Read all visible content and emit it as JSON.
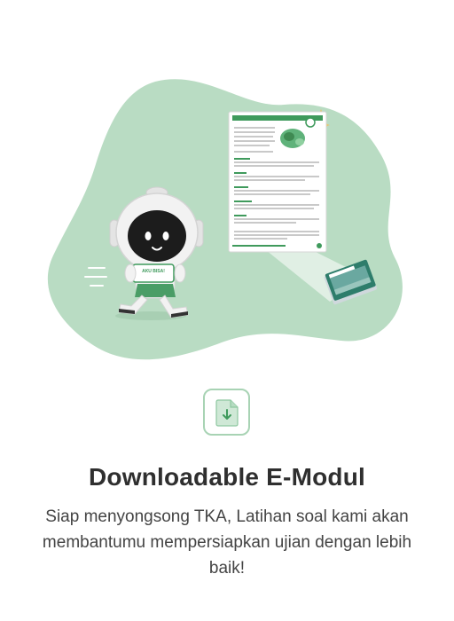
{
  "onboarding": {
    "title": "Downloadable E-Modul",
    "description": "Siap menyongsong TKA, Latihan soal kami akan  membantumu mempersiapkan ujian dengan lebih baik!"
  },
  "illustration": {
    "mascot_badge": "AKU BISA!"
  },
  "icons": {
    "download": "file-download-icon"
  },
  "colors": {
    "blob": "#b9dcc3",
    "accent": "#3f9a5c",
    "icon_border": "#a8d3b4",
    "icon_fill": "#cfe8d6",
    "title": "#2f2f2f",
    "text": "#444444"
  }
}
